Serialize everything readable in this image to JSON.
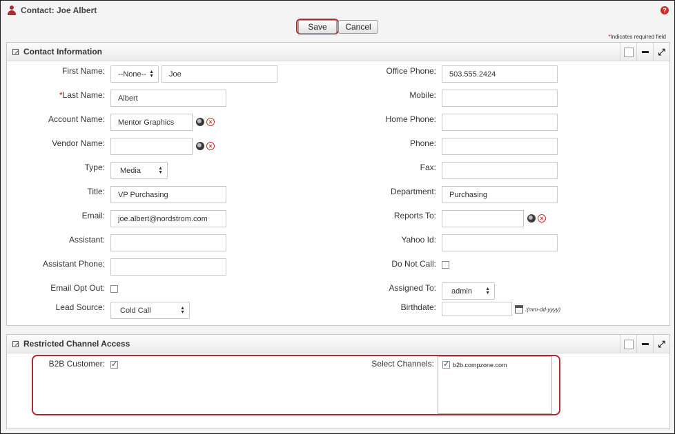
{
  "header": {
    "title": "Contact: Joe Albert",
    "help_icon": "help-icon"
  },
  "toolbar": {
    "save_label": "Save",
    "cancel_label": "Cancel"
  },
  "required_note": {
    "star": "*",
    "text": "Indicates required field"
  },
  "contact_panel": {
    "title": "Contact Information",
    "left": {
      "first_name": {
        "label": "First Name:",
        "salutation": "--None--",
        "value": "Joe"
      },
      "last_name": {
        "star": "*",
        "label": "Last Name:",
        "value": "Albert"
      },
      "account_name": {
        "label": "Account Name:",
        "value": "Mentor Graphics"
      },
      "vendor_name": {
        "label": "Vendor Name:",
        "value": ""
      },
      "type": {
        "label": "Type:",
        "value": "Media"
      },
      "title": {
        "label": "Title:",
        "value": "VP Purchasing"
      },
      "email": {
        "label": "Email:",
        "value": "joe.albert@nordstrom.com"
      },
      "assistant": {
        "label": "Assistant:",
        "value": ""
      },
      "assistant_phone": {
        "label": "Assistant Phone:",
        "value": ""
      },
      "email_opt_out": {
        "label": "Email Opt Out:",
        "checked": false
      },
      "lead_source": {
        "label": "Lead Source:",
        "value": "Cold Call"
      }
    },
    "right": {
      "office_phone": {
        "label": "Office Phone:",
        "value": "503.555.2424"
      },
      "mobile": {
        "label": "Mobile:",
        "value": ""
      },
      "home_phone": {
        "label": "Home Phone:",
        "value": ""
      },
      "phone": {
        "label": "Phone:",
        "value": ""
      },
      "fax": {
        "label": "Fax:",
        "value": ""
      },
      "department": {
        "label": "Department:",
        "value": "Purchasing"
      },
      "reports_to": {
        "label": "Reports To:",
        "value": ""
      },
      "yahoo_id": {
        "label": "Yahoo Id:",
        "value": ""
      },
      "do_not_call": {
        "label": "Do Not Call:",
        "checked": false
      },
      "assigned_to": {
        "label": "Assigned To:",
        "value": "admin"
      },
      "birthdate": {
        "label": "Birthdate:",
        "value": "",
        "hint": ":(mm-dd-yyyy)"
      }
    }
  },
  "channel_panel": {
    "title": "Restricted Channel Access",
    "b2b_customer": {
      "label": "B2B Customer:",
      "checked": true
    },
    "select_channels": {
      "label": "Select Channels:",
      "options": [
        {
          "label": "b2b.compzone.com",
          "checked": true
        }
      ]
    }
  },
  "colors": {
    "accent_red": "#b3282d",
    "panel_border": "#c9c9c9"
  }
}
